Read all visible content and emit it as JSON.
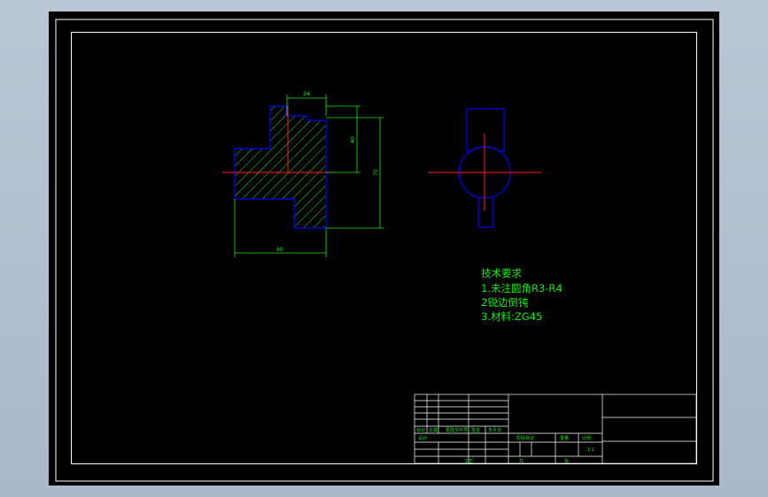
{
  "colors": {
    "frame": "#ffffff",
    "outline": "#0000ff",
    "hatch": "#19e619",
    "centerline": "#ff2020",
    "dimension": "#19e619",
    "text": "#19e619"
  },
  "dimensions": {
    "top_width": "24",
    "step_height": "40",
    "overall_height": "70",
    "overall_width": "60"
  },
  "technical_requirements": {
    "title": "技术要求",
    "items": [
      "1.未注圆角R3-R4",
      "2锐边倒钝",
      "3.材料:ZG45"
    ]
  },
  "title_block": {
    "scale": "1:1",
    "labels": {
      "mark": "标记",
      "count": "处数",
      "zone": "分区",
      "change_doc": "更改文件号",
      "signature": "签名",
      "date": "年月日",
      "designer": "设计",
      "stage_mark": "阶段标记",
      "weight": "重量",
      "scale_label": "比例",
      "approval": "批准",
      "process": "工艺",
      "sheet_total": "共",
      "sheet_num": "张"
    }
  }
}
